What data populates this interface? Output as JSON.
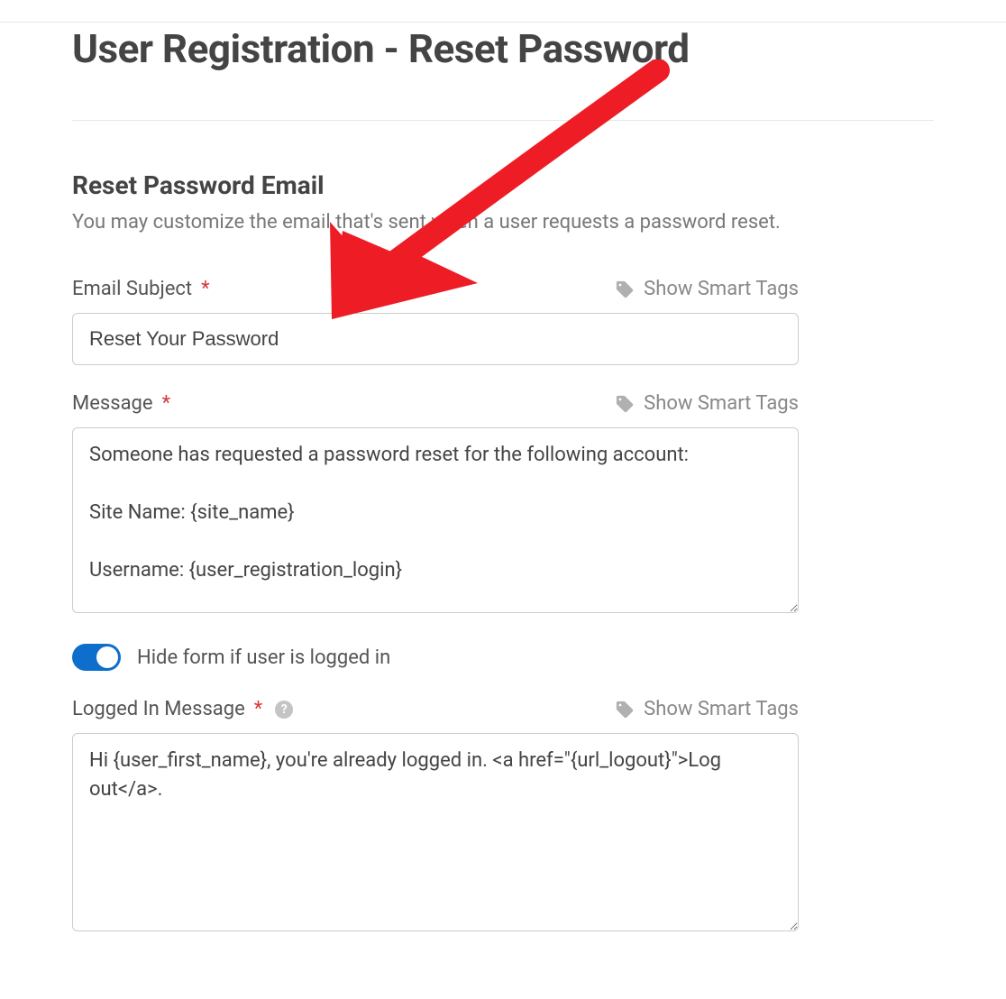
{
  "page": {
    "title": "User Registration - Reset Password"
  },
  "section": {
    "heading": "Reset Password Email",
    "description": "You may customize the email that's sent when a user requests a password reset."
  },
  "smart_tags_label": "Show Smart Tags",
  "fields": {
    "email_subject": {
      "label": "Email Subject",
      "value": "Reset Your Password"
    },
    "message": {
      "label": "Message",
      "value": "Someone has requested a password reset for the following account:\n\nSite Name: {site_name}\n\nUsername: {user_registration_login}"
    },
    "hide_if_logged_in": {
      "label": "Hide form if user is logged in",
      "enabled": true
    },
    "logged_in_message": {
      "label": "Logged In Message",
      "value": "Hi {user_first_name}, you're already logged in. <a href=\"{url_logout}\">Log out</a>."
    }
  }
}
